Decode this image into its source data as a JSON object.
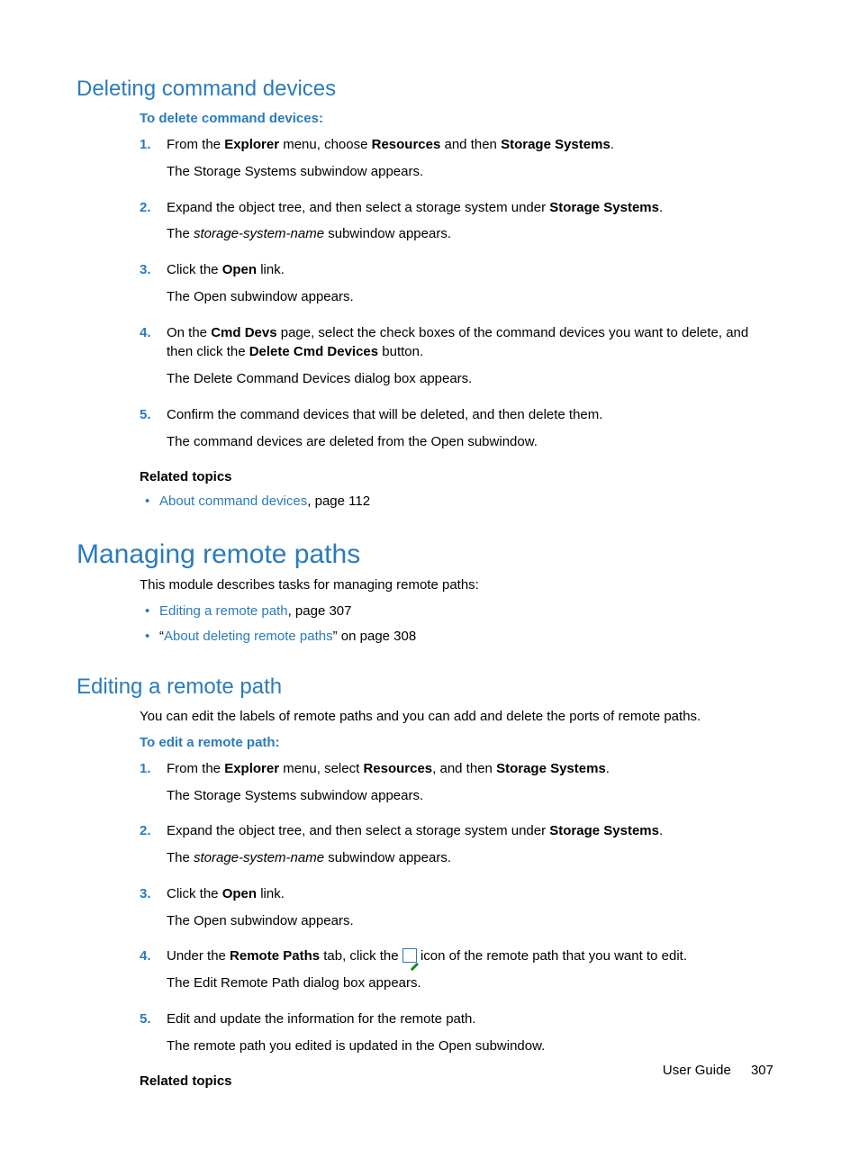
{
  "section1": {
    "heading": "Deleting command devices",
    "leadin": "To delete command devices:",
    "steps": [
      {
        "n": "1.",
        "parts": [
          "From the ",
          "Explorer",
          " menu, choose ",
          "Resources",
          " and then ",
          "Storage Systems",
          "."
        ],
        "result": "The Storage Systems subwindow appears."
      },
      {
        "n": "2.",
        "parts": [
          "Expand the object tree, and then select a storage system under ",
          "Storage Systems",
          "."
        ],
        "result_parts": [
          "The ",
          "storage-system-name",
          " subwindow appears."
        ]
      },
      {
        "n": "3.",
        "parts": [
          "Click the ",
          "Open",
          " link."
        ],
        "result": "The Open subwindow appears."
      },
      {
        "n": "4.",
        "parts": [
          "On the ",
          "Cmd Devs",
          " page, select the check boxes of the command devices you want to delete, and then click the ",
          "Delete Cmd Devices",
          " button."
        ],
        "result": "The Delete Command Devices dialog box appears."
      },
      {
        "n": "5.",
        "plain": "Confirm the command devices that will be deleted, and then delete them.",
        "result": "The command devices are deleted from the Open subwindow."
      }
    ],
    "related_heading": "Related topics",
    "related": [
      {
        "link": "About command devices",
        "tail": ", page 112"
      }
    ]
  },
  "section2": {
    "heading": "Managing remote paths",
    "intro": "This module describes tasks for managing remote paths:",
    "links": [
      {
        "pre": "",
        "link": "Editing a remote path",
        "tail": ", page 307"
      },
      {
        "pre": "“",
        "link": "About deleting remote paths",
        "tail": "” on page 308"
      }
    ]
  },
  "section3": {
    "heading": "Editing a remote path",
    "intro": "You can edit the labels of remote paths and you can add and delete the ports of remote paths.",
    "leadin": "To edit a remote path:",
    "steps": [
      {
        "n": "1.",
        "parts": [
          "From the ",
          "Explorer",
          " menu, select ",
          "Resources",
          ", and then ",
          "Storage Systems",
          "."
        ],
        "result": "The Storage Systems subwindow appears."
      },
      {
        "n": "2.",
        "parts": [
          "Expand the object tree, and then select a storage system under ",
          "Storage Systems",
          "."
        ],
        "result_parts": [
          "The ",
          "storage-system-name",
          " subwindow appears."
        ]
      },
      {
        "n": "3.",
        "parts": [
          "Click the ",
          "Open",
          " link."
        ],
        "result": "The Open subwindow appears."
      },
      {
        "n": "4.",
        "parts_icon": {
          "pre": [
            "Under the ",
            "Remote Paths",
            " tab, click the "
          ],
          "post": [
            " icon of the remote path that you want to edit."
          ]
        },
        "result": "The Edit Remote Path dialog box appears."
      },
      {
        "n": "5.",
        "plain": "Edit and update the information for the remote path.",
        "result": "The remote path you edited is updated in the Open subwindow."
      }
    ],
    "related_heading": "Related topics"
  },
  "footer": {
    "label": "User Guide",
    "page": "307"
  }
}
